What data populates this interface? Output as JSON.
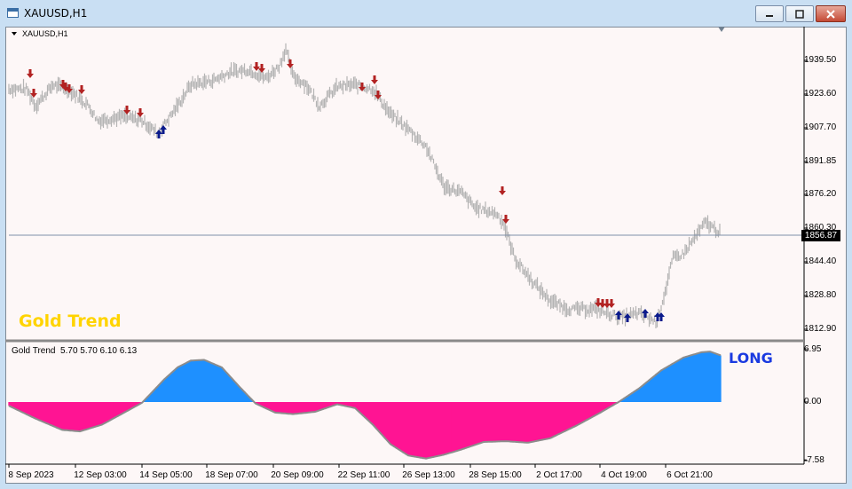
{
  "window": {
    "title": "XAUUSD,H1",
    "buttons": {
      "minimize": "minimize",
      "maximize": "maximize",
      "close": "close"
    }
  },
  "chart": {
    "symbol_label": "XAUUSD,H1",
    "current_price": "1856.87",
    "price_axis": [
      "1939.50",
      "1923.60",
      "1907.70",
      "1891.85",
      "1876.20",
      "1860.30",
      "1844.40",
      "1828.80",
      "1812.90"
    ],
    "indicator_label": "Gold Trend",
    "indicator_overlay_title": "Gold Trend",
    "indicator_values": "5.70 5.70 6.10 6.13",
    "signal_text": "LONG",
    "indicator_axis": [
      "6.95",
      "0.00",
      "-7.58"
    ],
    "time_axis": [
      "8 Sep 2023",
      "12 Sep 03:00",
      "14 Sep 05:00",
      "18 Sep 07:00",
      "20 Sep 09:00",
      "22 Sep 11:00",
      "26 Sep 13:00",
      "28 Sep 15:00",
      "2 Oct 17:00",
      "4 Oct 19:00",
      "6 Oct 21:00"
    ],
    "colors": {
      "bars": "#b4b4b4",
      "sell_arrow": "#b22222",
      "buy_arrow": "#0a1a8c",
      "hist_positive": "#1e90ff",
      "hist_negative": "#ff1493",
      "title_gold": "#ffd400",
      "long_blue": "#1a3ae0"
    }
  },
  "chart_data": [
    {
      "type": "line",
      "title": "XAUUSD,H1",
      "x": [
        "8 Sep 2023",
        "12 Sep 03:00",
        "14 Sep 05:00",
        "18 Sep 07:00",
        "20 Sep 09:00",
        "22 Sep 11:00",
        "26 Sep 13:00",
        "28 Sep 15:00",
        "2 Oct 17:00",
        "4 Oct 19:00",
        "6 Oct 21:00"
      ],
      "series": [
        {
          "values": [
            1926,
            1914,
            1911,
            1934,
            1928,
            1926,
            1877,
            1854,
            1822,
            1819,
            1863
          ]
        }
      ],
      "ylim": [
        1810,
        1946
      ],
      "grid": false,
      "current_price": 1856.87,
      "sell_signals": 22,
      "buy_signals": 9
    },
    {
      "type": "area",
      "title": "Gold Trend",
      "x": [
        "8 Sep 2023",
        "12 Sep 03:00",
        "14 Sep 05:00",
        "18 Sep 07:00",
        "20 Sep 09:00",
        "22 Sep 11:00",
        "26 Sep 13:00",
        "28 Sep 15:00",
        "2 Oct 17:00",
        "4 Oct 19:00",
        "6 Oct 21:00"
      ],
      "series": [
        {
          "values": [
            -0.5,
            -3.8,
            -0.2,
            5.8,
            -1.5,
            -0.3,
            -7.2,
            -5.2,
            -3.4,
            1.8,
            6.8
          ]
        }
      ],
      "ylim": [
        -7.58,
        6.95
      ],
      "legend": "top-left",
      "grid": false
    }
  ]
}
